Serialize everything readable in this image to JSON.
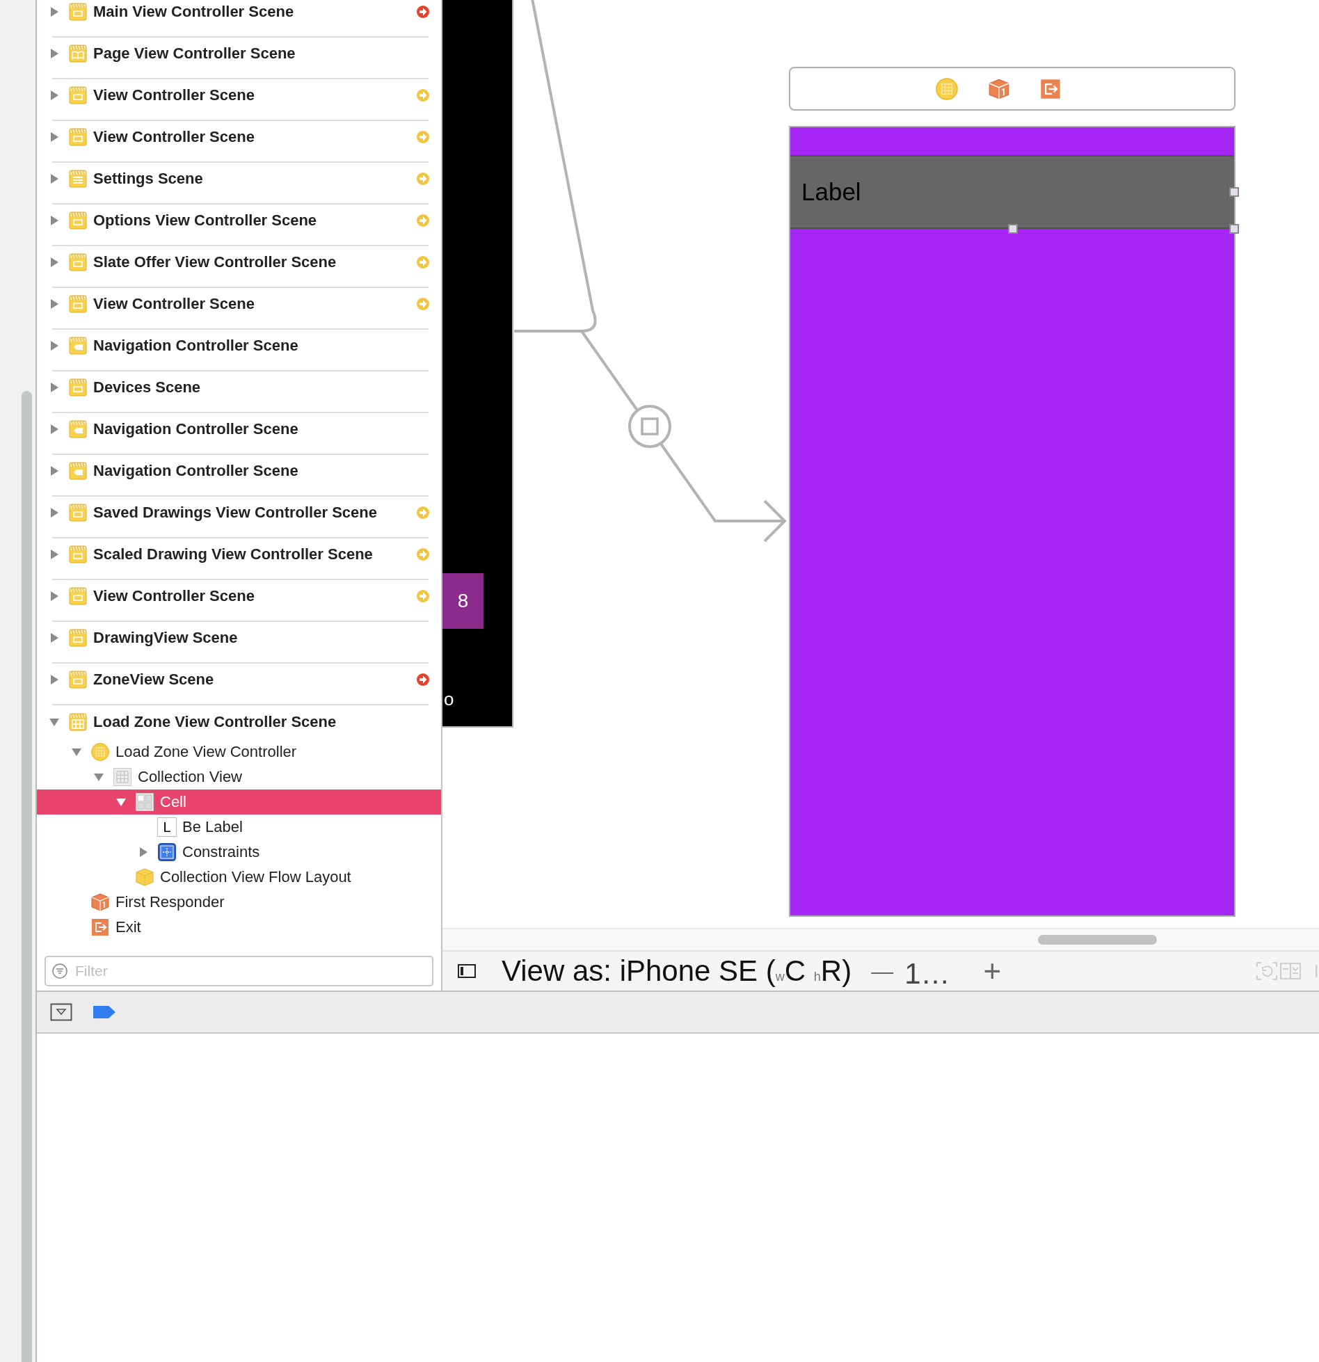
{
  "outline": {
    "scenes": [
      {
        "label": "Main View Controller Scene",
        "kind": "scene",
        "expanded": false,
        "selected": false,
        "color": "#e8402a"
      },
      {
        "label": "Page View Controller Scene",
        "kind": "page",
        "expanded": false,
        "selected": false
      },
      {
        "label": "View Controller Scene",
        "kind": "scene",
        "expanded": false,
        "selected": false,
        "color": "#f2c53d"
      },
      {
        "label": "View Controller Scene",
        "kind": "scene",
        "expanded": false,
        "selected": false,
        "color": "#f2c53d"
      },
      {
        "label": "Settings Scene",
        "kind": "settings",
        "expanded": false,
        "selected": false,
        "color": "#f2c53d"
      },
      {
        "label": "Options View Controller Scene",
        "kind": "scene",
        "expanded": false,
        "selected": false,
        "color": "#f2c53d"
      },
      {
        "label": "Slate Offer View Controller Scene",
        "kind": "scene",
        "expanded": false,
        "selected": false,
        "color": "#f2c53d"
      },
      {
        "label": "View Controller Scene",
        "kind": "scene",
        "expanded": false,
        "selected": false,
        "color": "#f2c53d"
      },
      {
        "label": "Navigation Controller Scene",
        "kind": "navigation",
        "expanded": false,
        "selected": false
      },
      {
        "label": "Devices Scene",
        "kind": "scene",
        "expanded": false,
        "selected": false
      },
      {
        "label": "Navigation Controller Scene",
        "kind": "navigation",
        "expanded": false,
        "selected": false
      },
      {
        "label": "Navigation Controller Scene",
        "kind": "navigation",
        "expanded": false,
        "selected": false
      },
      {
        "label": "Saved Drawings View Controller Scene",
        "kind": "scene",
        "expanded": false,
        "selected": false,
        "color": "#f2c53d"
      },
      {
        "label": "Scaled Drawing View Controller Scene",
        "kind": "scene",
        "expanded": false,
        "selected": false,
        "color": "#f2c53d"
      },
      {
        "label": "View Controller Scene",
        "kind": "scene",
        "expanded": false,
        "selected": false,
        "color": "#f2c53d"
      },
      {
        "label": "DrawingView Scene",
        "kind": "scene",
        "expanded": false,
        "selected": false
      },
      {
        "label": "ZoneView Scene",
        "kind": "scene",
        "expanded": false,
        "selected": false,
        "color": "#e8402a"
      },
      {
        "label": "Load Zone View Controller Scene",
        "kind": "collection",
        "expanded": true,
        "selected": false,
        "children": [
          {
            "label": "Load Zone View Controller",
            "kind": "controller",
            "expanded": true,
            "selected": false,
            "children": [
              {
                "label": "Collection View",
                "kind": "collection_view",
                "expanded": true,
                "selected": false,
                "children": [
                  {
                    "label": "Cell",
                    "kind": "cell",
                    "expanded": true,
                    "selected": true,
                    "children": [
                      {
                        "label": "Be Label",
                        "kind": "label",
                        "icon_glyph": "L",
                        "selected": false
                      },
                      {
                        "label": "Constraints",
                        "kind": "constraints",
                        "expanded": false,
                        "selected": false
                      }
                    ]
                  },
                  {
                    "label": "Collection View Flow Layout",
                    "kind": "flow_layout",
                    "selected": false
                  }
                ]
              }
            ]
          },
          {
            "label": "First Responder",
            "kind": "responder",
            "selected": false
          },
          {
            "label": "Exit",
            "kind": "exit",
            "selected": false
          }
        ]
      }
    ]
  },
  "filter": {
    "placeholder": "Filter"
  },
  "canvas": {
    "preview_tile": "8",
    "preview_text": "o",
    "label": "Label"
  },
  "toolbar": {
    "device": "View as: iPhone SE ($_{w}$C $_{h}$R)",
    "zoom_out": "—",
    "zoom_level": "1…",
    "zoom_in": "+"
  }
}
